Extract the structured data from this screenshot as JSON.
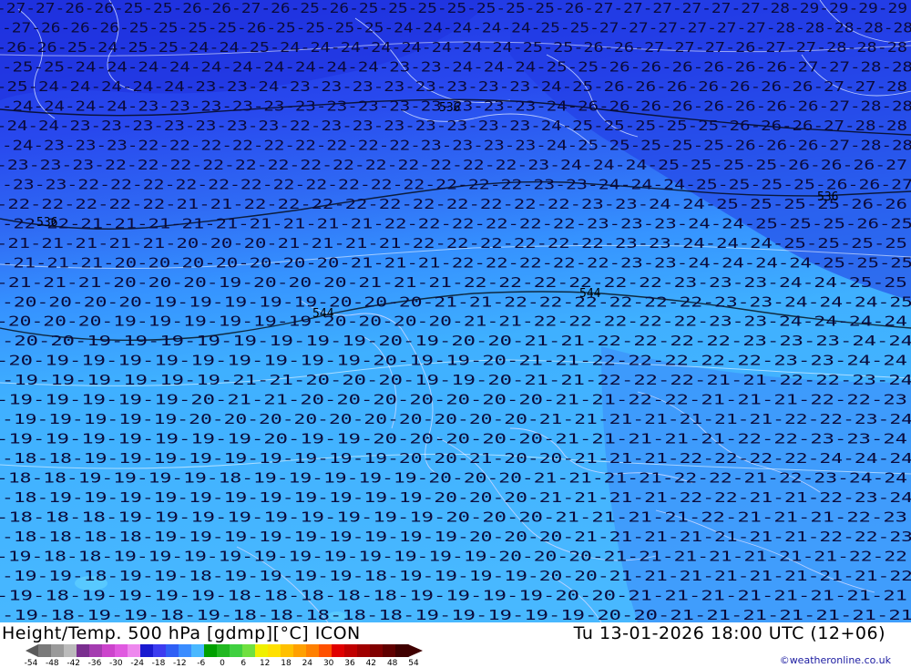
{
  "title": {
    "parameter": "Height/Temp. 500 hPa [gdmp][°C] ICON",
    "datetime": "Tu 13-01-2026 18:00 UTC (12+06)"
  },
  "credit": "©weatheronline.co.uk",
  "legend": {
    "ticks": [
      "-54",
      "-48",
      "-42",
      "-36",
      "-30",
      "-24",
      "-18",
      "-12",
      "-6",
      "0",
      "6",
      "12",
      "18",
      "24",
      "30",
      "36",
      "42",
      "48",
      "54"
    ],
    "colors": [
      "#7a7a7a",
      "#9a9a9a",
      "#bbbbbb",
      "#7a2f8f",
      "#a43cb0",
      "#cc44cc",
      "#e05ae0",
      "#ee88ee",
      "#1a1ad0",
      "#3c3cf0",
      "#2f5ff5",
      "#3a8cff",
      "#4ab8ff",
      "#00a000",
      "#20b820",
      "#40d040",
      "#70e040",
      "#f0f000",
      "#ffe000",
      "#ffc000",
      "#ffa000",
      "#ff8000",
      "#ff5000",
      "#e00000",
      "#c00000",
      "#a00000",
      "#800000",
      "#600000",
      "#400000"
    ]
  },
  "contours": {
    "levels": [
      "536",
      "544",
      "552"
    ]
  },
  "temperature_rows": [
    "-27-27-26-26-25-25-26-26-27-26-25-26-25-25-25-25-25-25-25-26-27-27-27-27-27-27-28-29-29-29-29",
    "-27-26-26-26-25-25-25-25-26-25-25-25-25-24-24-24-24-24-25-25-27-27-27-27-27-27-28-28-28-28-28",
    "-26-26-25-24-25-25-24-24-25-24-24-24-24-24-24-24-24-25-25-26-26-27-27-27-26-27-27-28-28-28",
    "-25-25-24-24-24-24-24-24-24-24-24-24-23-23-24-24-24-25-25-26-26-26-26-26-26-27-27-28-28",
    "-25-24-24-24-24-24-23-23-24-23-23-23-23-23-23-23-23-24-25-26-26-26-26-26-26-26-27-27-28",
    "-24-24-24-24-23-23-23-23-23-23-23-23-23-23-23-23-23-24-26-26-26-26-26-26-26-26-27-28-28",
    "-24-24-23-23-23-23-23-23-23-22-23-23-23-23-23-23-23-24-25-25-25-25-25-26-26-26-27-28-28",
    "-24-23-23-23-22-22-22-22-22-22-22-22-22-23-23-23-23-24-25-25-25-25-25-26-26-26-27-28-28",
    "-23-23-23-22-22-22-22-22-22-22-22-22-22-22-22-22-23-24-24-24-25-25-25-25-26-26-26-27",
    "-23-23-22-22-22-22-22-22-22-22-22-22-22-22-22-22-23-23-24-24-24-25-25-25-25-26-26-27",
    "-22-22-22-22-22-21-21-22-22-22-22-22-22-22-22-22-22-23-23-24-24-25-25-25-25-26-26",
    "-22-22-21-21-21-21-21-21-21-21-21-22-22-22-22-22-22-23-23-23-24-24-25-25-25-26-25",
    "-21-21-21-21-21-20-20-20-21-21-21-21-22-22-22-22-22-22-23-23-24-24-24-25-25-25-25",
    "-21-21-21-20-20-20-20-20-20-20-21-21-21-22-22-22-22-22-23-23-24-24-24-24-25-25-25",
    "-21-21-21-20-20-20-19-20-20-20-21-21-21-22-22-22-22-22-22-23-23-23-24-24-25-25",
    "-20-20-20-20-19-19-19-19-19-20-20-20-21-21-22-22-22-22-22-22-23-23-24-24-24-25",
    "-20-20-20-19-19-19-19-19-19-20-20-20-20-21-21-22-22-22-22-22-23-23-24-24-24-24",
    "-20-20-19-19-19-19-19-19-19-19-20-19-20-20-21-21-22-22-22-22-23-23-23-24-24",
    "-20-19-19-19-19-19-19-19-19-19-20-19-19-20-21-21-22-22-22-22-22-23-23-24-24",
    "-19-19-19-19-19-19-21-21-20-20-20-19-19-20-21-21-22-22-22-21-21-22-22-23-24",
    "-19-19-19-19-19-20-21-21-20-20-20-20-20-20-20-21-21-22-22-21-21-21-22-22-23",
    "-19-19-19-19-19-20-20-20-20-20-20-20-20-20-20-21-21-21-21-21-21-21-22-22-23-24",
    "-19-19-19-19-19-19-19-20-19-19-20-20-20-20-20-21-21-21-21-21-22-22-23-23-24",
    "-18-18-19-19-19-19-19-19-19-19-19-20-20-21-20-20-21-21-21-22-22-22-22-24-24-24",
    "-18-18-19-19-19-19-18-19-19-19-19-19-20-20-20-21-21-21-21-22-22-21-22-23-24-24",
    "-18-19-19-19-19-19-19-19-19-19-19-19-20-20-20-21-21-21-21-22-22-21-21-22-23-24",
    "-18-18-18-19-19-19-19-19-19-19-19-19-20-20-20-21-21-21-21-22-21-21-21-22-23",
    "-18-18-18-18-19-19-19-19-19-19-19-19-19-20-20-20-21-21-21-21-21-21-21-22-22-23",
    "-19-18-18-19-19-19-19-19-19-19-19-19-19-19-20-20-20-21-21-21-21-21-21-21-22-22",
    "-19-19-18-19-19-18-19-19-19-19-18-19-19-19-19-20-20-21-21-21-21-21-21-21-21-22",
    "-19-18-19-19-19-19-18-18-18-18-18-19-19-19-19-20-20-21-21-21-21-21-21-21-21",
    "-19-18-19-19-18-19-18-18-18-18-18-19-19-19-19-19-20-20-21-21-21-21-21-21-21"
  ]
}
